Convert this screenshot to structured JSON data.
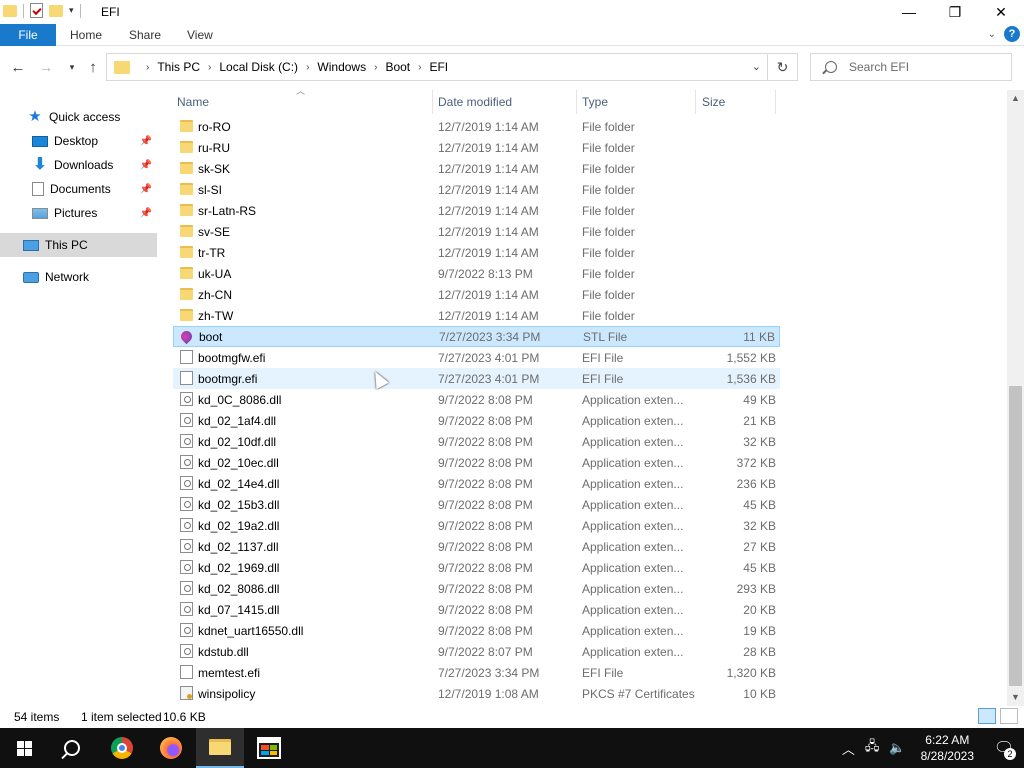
{
  "window": {
    "title": "EFI",
    "minimize": "—",
    "maximize": "❐",
    "close": "✕"
  },
  "ribbon": {
    "tabs": [
      "File",
      "Home",
      "Share",
      "View"
    ]
  },
  "address": {
    "crumbs": [
      "This PC",
      "Local Disk (C:)",
      "Windows",
      "Boot",
      "EFI"
    ],
    "search_placeholder": "Search EFI"
  },
  "nav": {
    "quick_access": "Quick access",
    "items": [
      {
        "label": "Desktop",
        "icon": "desktop-icon",
        "pinned": true
      },
      {
        "label": "Downloads",
        "icon": "downloads-icon",
        "pinned": true
      },
      {
        "label": "Documents",
        "icon": "documents-icon",
        "pinned": true
      },
      {
        "label": "Pictures",
        "icon": "pictures-icon",
        "pinned": true
      }
    ],
    "this_pc": "This PC",
    "network": "Network"
  },
  "columns": {
    "name": "Name",
    "date": "Date modified",
    "type": "Type",
    "size": "Size"
  },
  "files": [
    {
      "name": "ro-RO",
      "date": "12/7/2019 1:14 AM",
      "type": "File folder",
      "size": "",
      "icon": "folder"
    },
    {
      "name": "ru-RU",
      "date": "12/7/2019 1:14 AM",
      "type": "File folder",
      "size": "",
      "icon": "folder"
    },
    {
      "name": "sk-SK",
      "date": "12/7/2019 1:14 AM",
      "type": "File folder",
      "size": "",
      "icon": "folder"
    },
    {
      "name": "sl-SI",
      "date": "12/7/2019 1:14 AM",
      "type": "File folder",
      "size": "",
      "icon": "folder"
    },
    {
      "name": "sr-Latn-RS",
      "date": "12/7/2019 1:14 AM",
      "type": "File folder",
      "size": "",
      "icon": "folder"
    },
    {
      "name": "sv-SE",
      "date": "12/7/2019 1:14 AM",
      "type": "File folder",
      "size": "",
      "icon": "folder"
    },
    {
      "name": "tr-TR",
      "date": "12/7/2019 1:14 AM",
      "type": "File folder",
      "size": "",
      "icon": "folder"
    },
    {
      "name": "uk-UA",
      "date": "9/7/2022 8:13 PM",
      "type": "File folder",
      "size": "",
      "icon": "folder"
    },
    {
      "name": "zh-CN",
      "date": "12/7/2019 1:14 AM",
      "type": "File folder",
      "size": "",
      "icon": "folder"
    },
    {
      "name": "zh-TW",
      "date": "12/7/2019 1:14 AM",
      "type": "File folder",
      "size": "",
      "icon": "folder"
    },
    {
      "name": "boot",
      "date": "7/27/2023 3:34 PM",
      "type": "STL File",
      "size": "11 KB",
      "icon": "stl",
      "state": "selected"
    },
    {
      "name": "bootmgfw.efi",
      "date": "7/27/2023 4:01 PM",
      "type": "EFI File",
      "size": "1,552 KB",
      "icon": "file"
    },
    {
      "name": "bootmgr.efi",
      "date": "7/27/2023 4:01 PM",
      "type": "EFI File",
      "size": "1,536 KB",
      "icon": "file",
      "state": "hover"
    },
    {
      "name": "kd_0C_8086.dll",
      "date": "9/7/2022 8:08 PM",
      "type": "Application exten...",
      "size": "49 KB",
      "icon": "dll"
    },
    {
      "name": "kd_02_1af4.dll",
      "date": "9/7/2022 8:08 PM",
      "type": "Application exten...",
      "size": "21 KB",
      "icon": "dll"
    },
    {
      "name": "kd_02_10df.dll",
      "date": "9/7/2022 8:08 PM",
      "type": "Application exten...",
      "size": "32 KB",
      "icon": "dll"
    },
    {
      "name": "kd_02_10ec.dll",
      "date": "9/7/2022 8:08 PM",
      "type": "Application exten...",
      "size": "372 KB",
      "icon": "dll"
    },
    {
      "name": "kd_02_14e4.dll",
      "date": "9/7/2022 8:08 PM",
      "type": "Application exten...",
      "size": "236 KB",
      "icon": "dll"
    },
    {
      "name": "kd_02_15b3.dll",
      "date": "9/7/2022 8:08 PM",
      "type": "Application exten...",
      "size": "45 KB",
      "icon": "dll"
    },
    {
      "name": "kd_02_19a2.dll",
      "date": "9/7/2022 8:08 PM",
      "type": "Application exten...",
      "size": "32 KB",
      "icon": "dll"
    },
    {
      "name": "kd_02_1137.dll",
      "date": "9/7/2022 8:08 PM",
      "type": "Application exten...",
      "size": "27 KB",
      "icon": "dll"
    },
    {
      "name": "kd_02_1969.dll",
      "date": "9/7/2022 8:08 PM",
      "type": "Application exten...",
      "size": "45 KB",
      "icon": "dll"
    },
    {
      "name": "kd_02_8086.dll",
      "date": "9/7/2022 8:08 PM",
      "type": "Application exten...",
      "size": "293 KB",
      "icon": "dll"
    },
    {
      "name": "kd_07_1415.dll",
      "date": "9/7/2022 8:08 PM",
      "type": "Application exten...",
      "size": "20 KB",
      "icon": "dll"
    },
    {
      "name": "kdnet_uart16550.dll",
      "date": "9/7/2022 8:08 PM",
      "type": "Application exten...",
      "size": "19 KB",
      "icon": "dll"
    },
    {
      "name": "kdstub.dll",
      "date": "9/7/2022 8:07 PM",
      "type": "Application exten...",
      "size": "28 KB",
      "icon": "dll"
    },
    {
      "name": "memtest.efi",
      "date": "7/27/2023 3:34 PM",
      "type": "EFI File",
      "size": "1,320 KB",
      "icon": "file"
    },
    {
      "name": "winsipolicy",
      "date": "12/7/2019 1:08 AM",
      "type": "PKCS #7 Certificates",
      "size": "10 KB",
      "icon": "cert"
    }
  ],
  "status": {
    "items": "54 items",
    "selected": "1 item selected",
    "size": "10.6 KB"
  },
  "taskbar": {
    "time": "6:22 AM",
    "date": "8/28/2023",
    "notifications": "2"
  }
}
